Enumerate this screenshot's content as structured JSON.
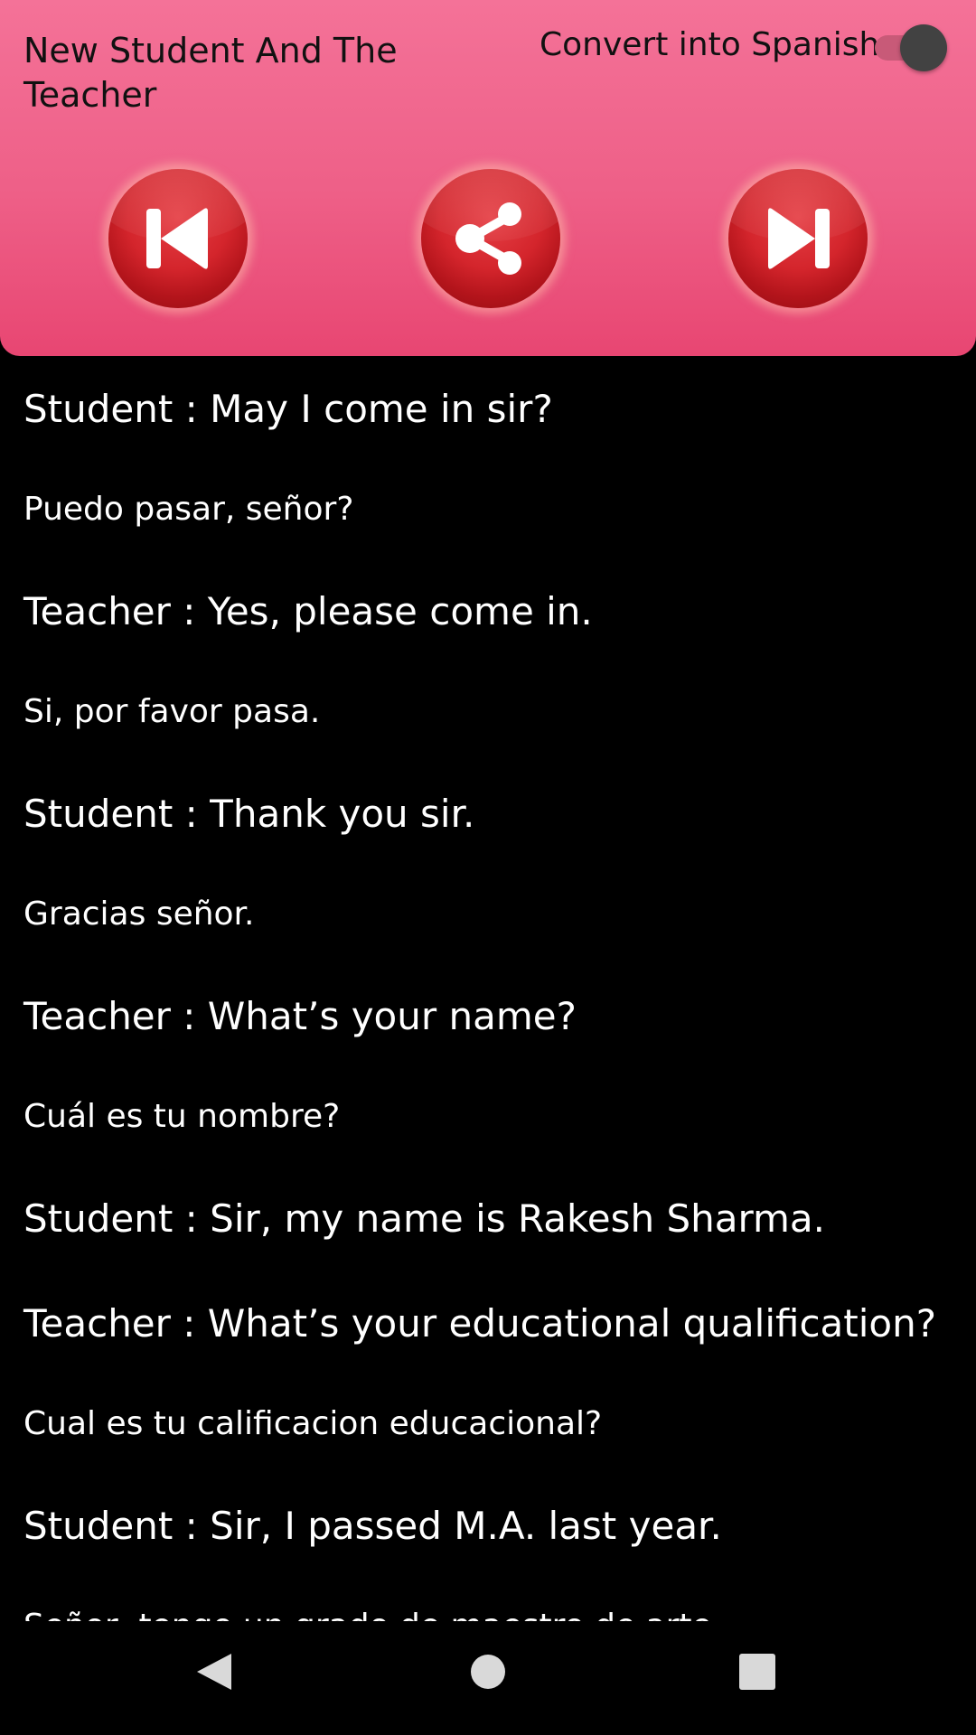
{
  "header": {
    "title": "New Student And The Teacher",
    "toggle_label": "Convert into Spanish",
    "toggle_on": true,
    "prev_icon": "skip-previous-icon",
    "share_icon": "share-icon",
    "next_icon": "skip-next-icon"
  },
  "dialog": [
    {
      "text": "Student : May I come in sir?",
      "lang": "en"
    },
    {
      "text": "Puedo pasar, señor?",
      "lang": "es"
    },
    {
      "text": "Teacher : Yes, please come in.",
      "lang": "en"
    },
    {
      "text": "Si, por favor pasa.",
      "lang": "es"
    },
    {
      "text": "Student : Thank you sir.",
      "lang": "en"
    },
    {
      "text": "Gracias señor.",
      "lang": "es"
    },
    {
      "text": "Teacher : What’s your name?",
      "lang": "en"
    },
    {
      "text": "Cuál es tu nombre?",
      "lang": "es"
    },
    {
      "text": "Student : Sir,  my name is Rakesh Sharma.",
      "lang": "en"
    },
    {
      "text": "Teacher : What’s your educational qualification?",
      "lang": "en"
    },
    {
      "text": "Cual es tu calificacion educacional?",
      "lang": "es"
    },
    {
      "text": "Student : Sir, I passed M.A. last year.",
      "lang": "en"
    },
    {
      "text": "Señor, tengo un grado de maestro de arte.",
      "lang": "es"
    }
  ],
  "navbar": {
    "back_icon": "back-triangle-icon",
    "home_icon": "home-circle-icon",
    "recents_icon": "recents-square-icon"
  },
  "colors": {
    "header_gradient_top": "#f47298",
    "header_gradient_bottom": "#e84672",
    "button_red": "#d4252c",
    "background": "#000000",
    "text_light": "#ffffff",
    "text_dark": "#111111"
  }
}
